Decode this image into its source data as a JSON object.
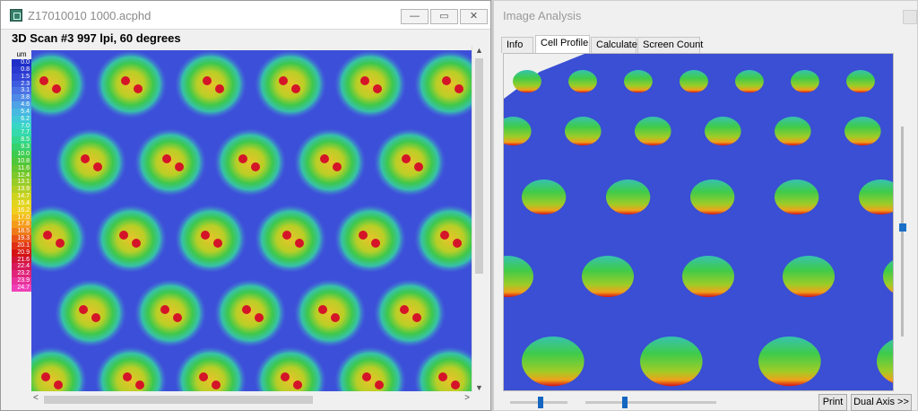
{
  "left_window": {
    "title": "Z17010010 1000.acphd",
    "buttons": {
      "minimize": "—",
      "maximize": "▭",
      "close": "✕"
    },
    "scan_title": "3D Scan #3 997 lpi, 60 degrees",
    "legend_unit": "um",
    "legend": [
      {
        "v": "0.0",
        "c": "#1f2fc8"
      },
      {
        "v": "0.8",
        "c": "#2a3ad0"
      },
      {
        "v": "1.5",
        "c": "#3447d8"
      },
      {
        "v": "2.3",
        "c": "#3d5ce0"
      },
      {
        "v": "3.1",
        "c": "#4a73e4"
      },
      {
        "v": "3.8",
        "c": "#4f8ae7"
      },
      {
        "v": "4.6",
        "c": "#4ea3e6"
      },
      {
        "v": "5.4",
        "c": "#47b9e0"
      },
      {
        "v": "6.2",
        "c": "#3fc9d6"
      },
      {
        "v": "7.0",
        "c": "#37d6c5"
      },
      {
        "v": "7.7",
        "c": "#34d9ac"
      },
      {
        "v": "8.5",
        "c": "#33d88e"
      },
      {
        "v": "9.3",
        "c": "#35d16d"
      },
      {
        "v": "10.0",
        "c": "#3ecb4d"
      },
      {
        "v": "10.8",
        "c": "#50c73a"
      },
      {
        "v": "11.6",
        "c": "#66c72f"
      },
      {
        "v": "12.4",
        "c": "#7ec92a"
      },
      {
        "v": "13.1",
        "c": "#99cc27"
      },
      {
        "v": "13.9",
        "c": "#b4d024"
      },
      {
        "v": "14.7",
        "c": "#cfd421"
      },
      {
        "v": "15.4",
        "c": "#e3d51f"
      },
      {
        "v": "16.2",
        "c": "#f0ce1e"
      },
      {
        "v": "17.0",
        "c": "#f4b81c"
      },
      {
        "v": "17.8",
        "c": "#f49b1a"
      },
      {
        "v": "18.5",
        "c": "#ef7a18"
      },
      {
        "v": "19.3",
        "c": "#e95416"
      },
      {
        "v": "20.1",
        "c": "#e03014"
      },
      {
        "v": "20.9",
        "c": "#d41414"
      },
      {
        "v": "21.6",
        "c": "#d31438"
      },
      {
        "v": "22.4",
        "c": "#d81a5a"
      },
      {
        "v": "23.2",
        "c": "#e0257a"
      },
      {
        "v": "23.9",
        "c": "#e8339a"
      },
      {
        "v": "24.7",
        "c": "#f040b8"
      }
    ]
  },
  "right_window": {
    "title": "Image Analysis",
    "tabs": [
      "Info",
      "Cell Profile",
      "Calculate",
      "Screen Count"
    ],
    "active_tab": "Cell Profile",
    "buttons": {
      "print": "Print",
      "dual_axis": "Dual Axis >>"
    },
    "sliders": [
      0.3,
      0.3
    ]
  },
  "colors": {
    "cell_wall": "#3c4fd8",
    "cell_rim": "#35c76a",
    "cell_peak": "#d41414"
  }
}
